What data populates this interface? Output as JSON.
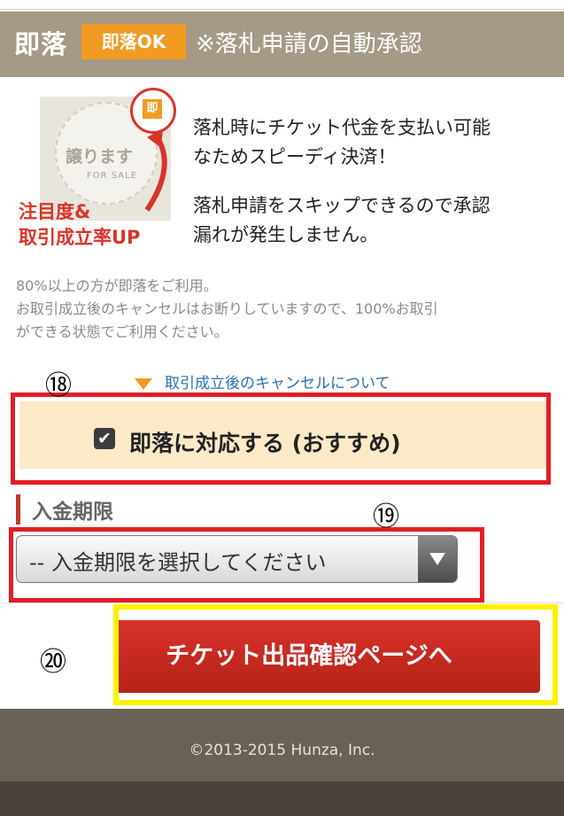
{
  "header": {
    "title": "即落",
    "badge": "即落OK",
    "note": "※落札申請の自動承認"
  },
  "promo": {
    "stamp_text": "譲ります",
    "stamp_sub": "FOR SALE",
    "tag": "即",
    "caption_line1": "注目度&",
    "caption_line2": "取引成立率UP"
  },
  "features": {
    "p1_line1": "落札時にチケット代金を支払い可能",
    "p1_line2": "なためスピーディ決済！",
    "p2_line1": "落札申請をスキップできるので承認",
    "p2_line2": "漏れが発生しません。"
  },
  "info": {
    "line1": "80%以上の方が即落をご利用。",
    "line2": "お取引成立後のキャンセルはお断りしていますので、100%お取引",
    "line3": "ができる状態でご利用ください。"
  },
  "cancel_link": "取引成立後のキャンセルについて",
  "checkbox": {
    "label": "即落に対応する (おすすめ)",
    "checked": true,
    "mark": "✔"
  },
  "deadline": {
    "label": "入金期限",
    "select_value": "-- 入金期限を選択してください"
  },
  "confirm_button": "チケット出品確認ページへ",
  "annotations": {
    "n18": "⑱",
    "n19": "⑲",
    "n20": "⑳"
  },
  "footer": {
    "copyright": "©2013-2015 Hunza, Inc."
  },
  "colors": {
    "header_bg": "#a49a86",
    "badge_bg": "#f29b22",
    "button_red": "#c62a20",
    "annotation_red": "#e21d25",
    "annotation_yellow": "#fff200",
    "footer_bg": "#6a6156"
  }
}
